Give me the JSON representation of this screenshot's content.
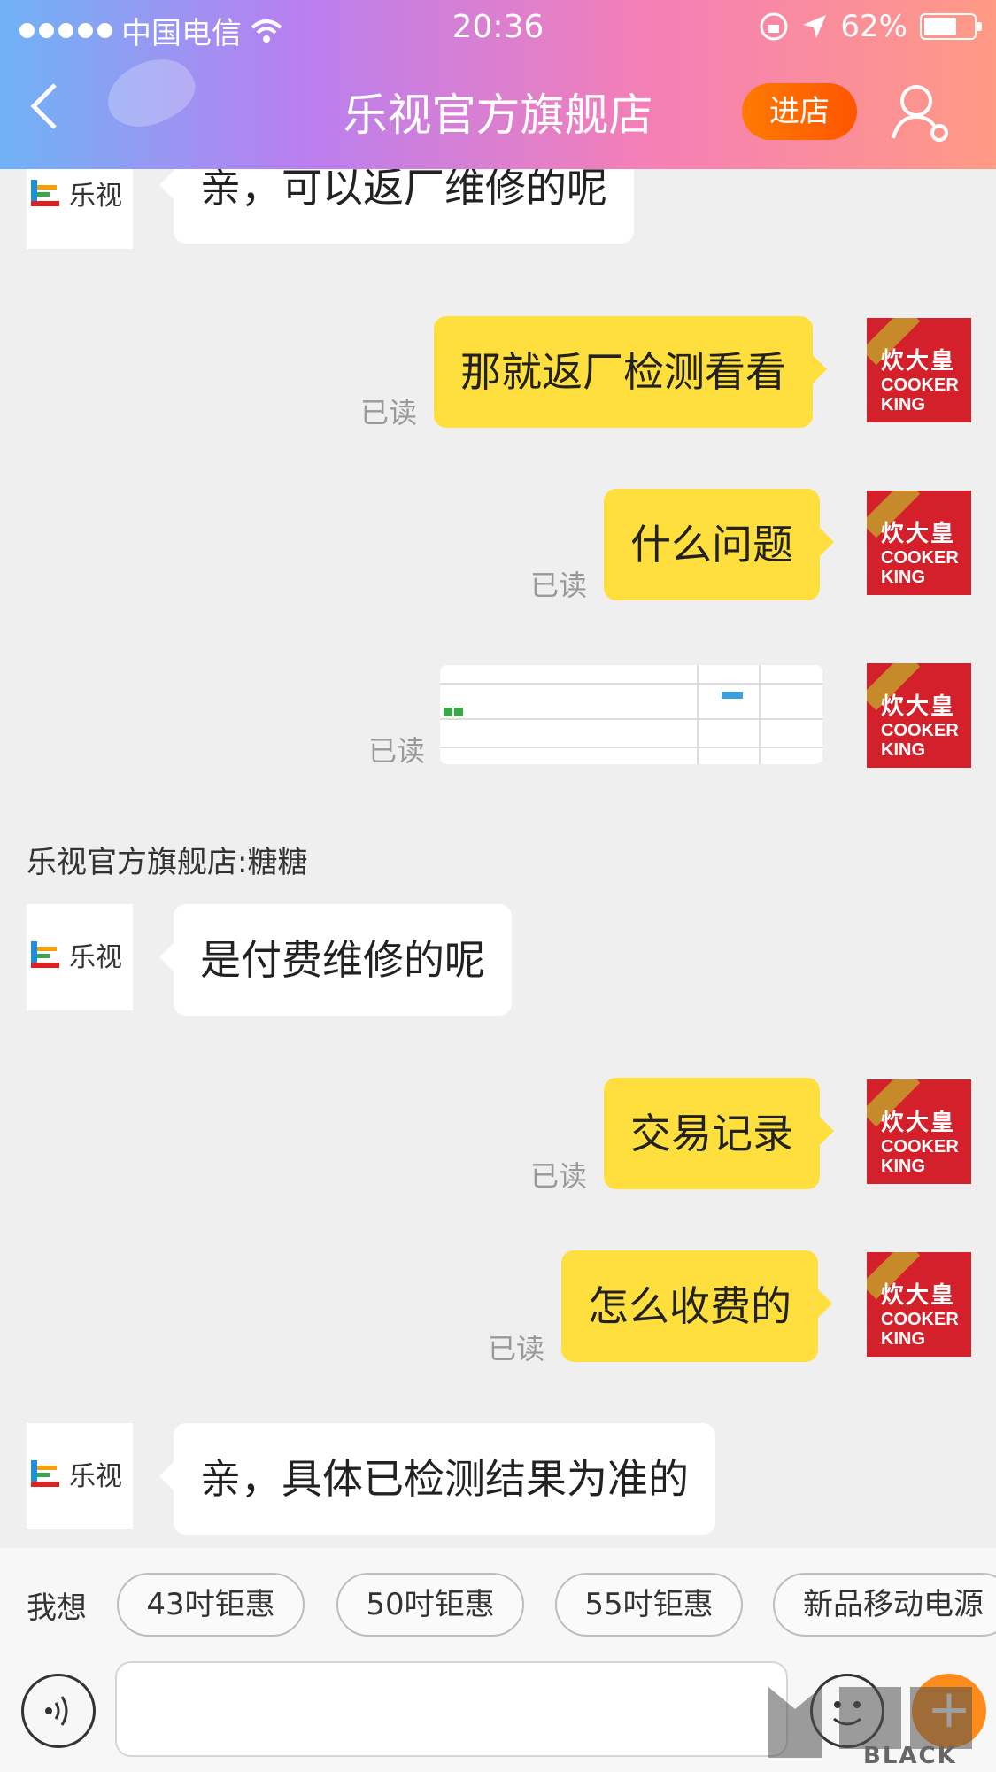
{
  "status_bar": {
    "carrier": "中国电信",
    "time": "20:36",
    "battery": "62%"
  },
  "header": {
    "title": "乐视官方旗舰店",
    "enter_store": "进店"
  },
  "brand": {
    "le_text": "乐视",
    "ck_cn": "炊大皇",
    "ck_en_1": "COOKER",
    "ck_en_2": "KING"
  },
  "messages": [
    {
      "side": "left",
      "text": "亲，可以返厂维修的呢"
    },
    {
      "side": "right",
      "text": "那就返厂检测看看",
      "status": "已读"
    },
    {
      "side": "right",
      "text": "什么问题",
      "status": "已读"
    },
    {
      "side": "right",
      "type": "image",
      "status": "已读"
    },
    {
      "side": "left",
      "sender": "乐视官方旗舰店:糖糖",
      "text": "是付费维修的呢"
    },
    {
      "side": "right",
      "text": "交易记录",
      "status": "已读"
    },
    {
      "side": "right",
      "text": "怎么收费的",
      "status": "已读"
    },
    {
      "side": "left",
      "text": "亲，具体已检测结果为准的"
    }
  ],
  "quick_replies": {
    "label": "我想",
    "items": [
      "43吋钜惠",
      "50吋钜惠",
      "55吋钜惠",
      "新品移动电源"
    ]
  },
  "colors": {
    "accent_orange": "#ff7a00",
    "bubble_yellow": "#ffdf3d",
    "brand_red": "#d4202a"
  },
  "watermark": "BLACK CAT"
}
